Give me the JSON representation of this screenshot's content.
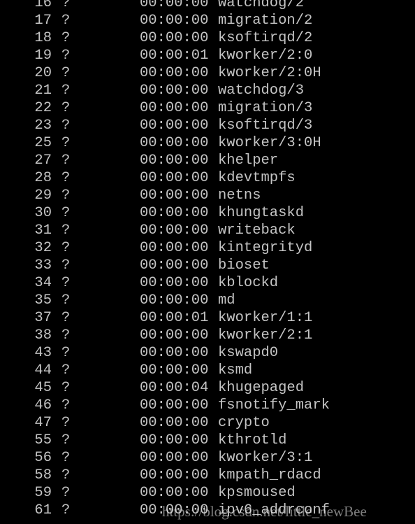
{
  "processes": [
    {
      "pid": "16",
      "tty": "?",
      "time": "00:00:00",
      "cmd": "watchdog/2"
    },
    {
      "pid": "17",
      "tty": "?",
      "time": "00:00:00",
      "cmd": "migration/2"
    },
    {
      "pid": "18",
      "tty": "?",
      "time": "00:00:00",
      "cmd": "ksoftirqd/2"
    },
    {
      "pid": "19",
      "tty": "?",
      "time": "00:00:01",
      "cmd": "kworker/2:0"
    },
    {
      "pid": "20",
      "tty": "?",
      "time": "00:00:00",
      "cmd": "kworker/2:0H"
    },
    {
      "pid": "21",
      "tty": "?",
      "time": "00:00:00",
      "cmd": "watchdog/3"
    },
    {
      "pid": "22",
      "tty": "?",
      "time": "00:00:00",
      "cmd": "migration/3"
    },
    {
      "pid": "23",
      "tty": "?",
      "time": "00:00:00",
      "cmd": "ksoftirqd/3"
    },
    {
      "pid": "25",
      "tty": "?",
      "time": "00:00:00",
      "cmd": "kworker/3:0H"
    },
    {
      "pid": "27",
      "tty": "?",
      "time": "00:00:00",
      "cmd": "khelper"
    },
    {
      "pid": "28",
      "tty": "?",
      "time": "00:00:00",
      "cmd": "kdevtmpfs"
    },
    {
      "pid": "29",
      "tty": "?",
      "time": "00:00:00",
      "cmd": "netns"
    },
    {
      "pid": "30",
      "tty": "?",
      "time": "00:00:00",
      "cmd": "khungtaskd"
    },
    {
      "pid": "31",
      "tty": "?",
      "time": "00:00:00",
      "cmd": "writeback"
    },
    {
      "pid": "32",
      "tty": "?",
      "time": "00:00:00",
      "cmd": "kintegrityd"
    },
    {
      "pid": "33",
      "tty": "?",
      "time": "00:00:00",
      "cmd": "bioset"
    },
    {
      "pid": "34",
      "tty": "?",
      "time": "00:00:00",
      "cmd": "kblockd"
    },
    {
      "pid": "35",
      "tty": "?",
      "time": "00:00:00",
      "cmd": "md"
    },
    {
      "pid": "37",
      "tty": "?",
      "time": "00:00:01",
      "cmd": "kworker/1:1"
    },
    {
      "pid": "38",
      "tty": "?",
      "time": "00:00:00",
      "cmd": "kworker/2:1"
    },
    {
      "pid": "43",
      "tty": "?",
      "time": "00:00:00",
      "cmd": "kswapd0"
    },
    {
      "pid": "44",
      "tty": "?",
      "time": "00:00:00",
      "cmd": "ksmd"
    },
    {
      "pid": "45",
      "tty": "?",
      "time": "00:00:04",
      "cmd": "khugepaged"
    },
    {
      "pid": "46",
      "tty": "?",
      "time": "00:00:00",
      "cmd": "fsnotify_mark"
    },
    {
      "pid": "47",
      "tty": "?",
      "time": "00:00:00",
      "cmd": "crypto"
    },
    {
      "pid": "55",
      "tty": "?",
      "time": "00:00:00",
      "cmd": "kthrotld"
    },
    {
      "pid": "56",
      "tty": "?",
      "time": "00:00:00",
      "cmd": "kworker/3:1"
    },
    {
      "pid": "58",
      "tty": "?",
      "time": "00:00:00",
      "cmd": "kmpath_rdacd"
    },
    {
      "pid": "59",
      "tty": "?",
      "time": "00:00:00",
      "cmd": "kpsmoused"
    },
    {
      "pid": "61",
      "tty": "?",
      "time": "00:00:00",
      "cmd": "ipv6_addrconf"
    }
  ],
  "watermark": "https://blog.csdn.net/little_newBee"
}
